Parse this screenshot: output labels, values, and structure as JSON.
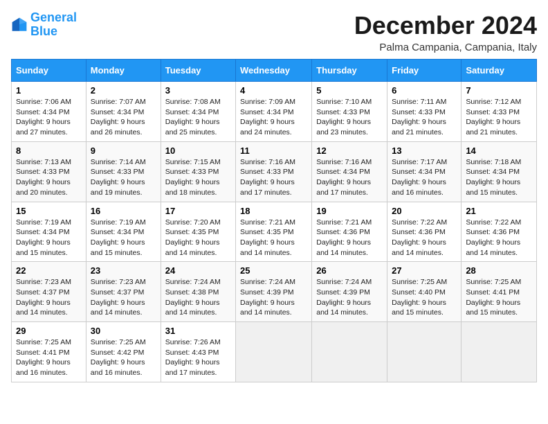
{
  "logo": {
    "line1": "General",
    "line2": "Blue"
  },
  "title": "December 2024",
  "subtitle": "Palma Campania, Campania, Italy",
  "days_of_week": [
    "Sunday",
    "Monday",
    "Tuesday",
    "Wednesday",
    "Thursday",
    "Friday",
    "Saturday"
  ],
  "weeks": [
    [
      {
        "day": "1",
        "sunrise": "7:06 AM",
        "sunset": "4:34 PM",
        "daylight": "9 hours and 27 minutes."
      },
      {
        "day": "2",
        "sunrise": "7:07 AM",
        "sunset": "4:34 PM",
        "daylight": "9 hours and 26 minutes."
      },
      {
        "day": "3",
        "sunrise": "7:08 AM",
        "sunset": "4:34 PM",
        "daylight": "9 hours and 25 minutes."
      },
      {
        "day": "4",
        "sunrise": "7:09 AM",
        "sunset": "4:34 PM",
        "daylight": "9 hours and 24 minutes."
      },
      {
        "day": "5",
        "sunrise": "7:10 AM",
        "sunset": "4:33 PM",
        "daylight": "9 hours and 23 minutes."
      },
      {
        "day": "6",
        "sunrise": "7:11 AM",
        "sunset": "4:33 PM",
        "daylight": "9 hours and 21 minutes."
      },
      {
        "day": "7",
        "sunrise": "7:12 AM",
        "sunset": "4:33 PM",
        "daylight": "9 hours and 21 minutes."
      }
    ],
    [
      {
        "day": "8",
        "sunrise": "7:13 AM",
        "sunset": "4:33 PM",
        "daylight": "9 hours and 20 minutes."
      },
      {
        "day": "9",
        "sunrise": "7:14 AM",
        "sunset": "4:33 PM",
        "daylight": "9 hours and 19 minutes."
      },
      {
        "day": "10",
        "sunrise": "7:15 AM",
        "sunset": "4:33 PM",
        "daylight": "9 hours and 18 minutes."
      },
      {
        "day": "11",
        "sunrise": "7:16 AM",
        "sunset": "4:33 PM",
        "daylight": "9 hours and 17 minutes."
      },
      {
        "day": "12",
        "sunrise": "7:16 AM",
        "sunset": "4:34 PM",
        "daylight": "9 hours and 17 minutes."
      },
      {
        "day": "13",
        "sunrise": "7:17 AM",
        "sunset": "4:34 PM",
        "daylight": "9 hours and 16 minutes."
      },
      {
        "day": "14",
        "sunrise": "7:18 AM",
        "sunset": "4:34 PM",
        "daylight": "9 hours and 15 minutes."
      }
    ],
    [
      {
        "day": "15",
        "sunrise": "7:19 AM",
        "sunset": "4:34 PM",
        "daylight": "9 hours and 15 minutes."
      },
      {
        "day": "16",
        "sunrise": "7:19 AM",
        "sunset": "4:34 PM",
        "daylight": "9 hours and 15 minutes."
      },
      {
        "day": "17",
        "sunrise": "7:20 AM",
        "sunset": "4:35 PM",
        "daylight": "9 hours and 14 minutes."
      },
      {
        "day": "18",
        "sunrise": "7:21 AM",
        "sunset": "4:35 PM",
        "daylight": "9 hours and 14 minutes."
      },
      {
        "day": "19",
        "sunrise": "7:21 AM",
        "sunset": "4:36 PM",
        "daylight": "9 hours and 14 minutes."
      },
      {
        "day": "20",
        "sunrise": "7:22 AM",
        "sunset": "4:36 PM",
        "daylight": "9 hours and 14 minutes."
      },
      {
        "day": "21",
        "sunrise": "7:22 AM",
        "sunset": "4:36 PM",
        "daylight": "9 hours and 14 minutes."
      }
    ],
    [
      {
        "day": "22",
        "sunrise": "7:23 AM",
        "sunset": "4:37 PM",
        "daylight": "9 hours and 14 minutes."
      },
      {
        "day": "23",
        "sunrise": "7:23 AM",
        "sunset": "4:37 PM",
        "daylight": "9 hours and 14 minutes."
      },
      {
        "day": "24",
        "sunrise": "7:24 AM",
        "sunset": "4:38 PM",
        "daylight": "9 hours and 14 minutes."
      },
      {
        "day": "25",
        "sunrise": "7:24 AM",
        "sunset": "4:39 PM",
        "daylight": "9 hours and 14 minutes."
      },
      {
        "day": "26",
        "sunrise": "7:24 AM",
        "sunset": "4:39 PM",
        "daylight": "9 hours and 14 minutes."
      },
      {
        "day": "27",
        "sunrise": "7:25 AM",
        "sunset": "4:40 PM",
        "daylight": "9 hours and 15 minutes."
      },
      {
        "day": "28",
        "sunrise": "7:25 AM",
        "sunset": "4:41 PM",
        "daylight": "9 hours and 15 minutes."
      }
    ],
    [
      {
        "day": "29",
        "sunrise": "7:25 AM",
        "sunset": "4:41 PM",
        "daylight": "9 hours and 16 minutes."
      },
      {
        "day": "30",
        "sunrise": "7:25 AM",
        "sunset": "4:42 PM",
        "daylight": "9 hours and 16 minutes."
      },
      {
        "day": "31",
        "sunrise": "7:26 AM",
        "sunset": "4:43 PM",
        "daylight": "9 hours and 17 minutes."
      },
      null,
      null,
      null,
      null
    ]
  ],
  "labels": {
    "sunrise": "Sunrise:",
    "sunset": "Sunset:",
    "daylight": "Daylight:"
  }
}
